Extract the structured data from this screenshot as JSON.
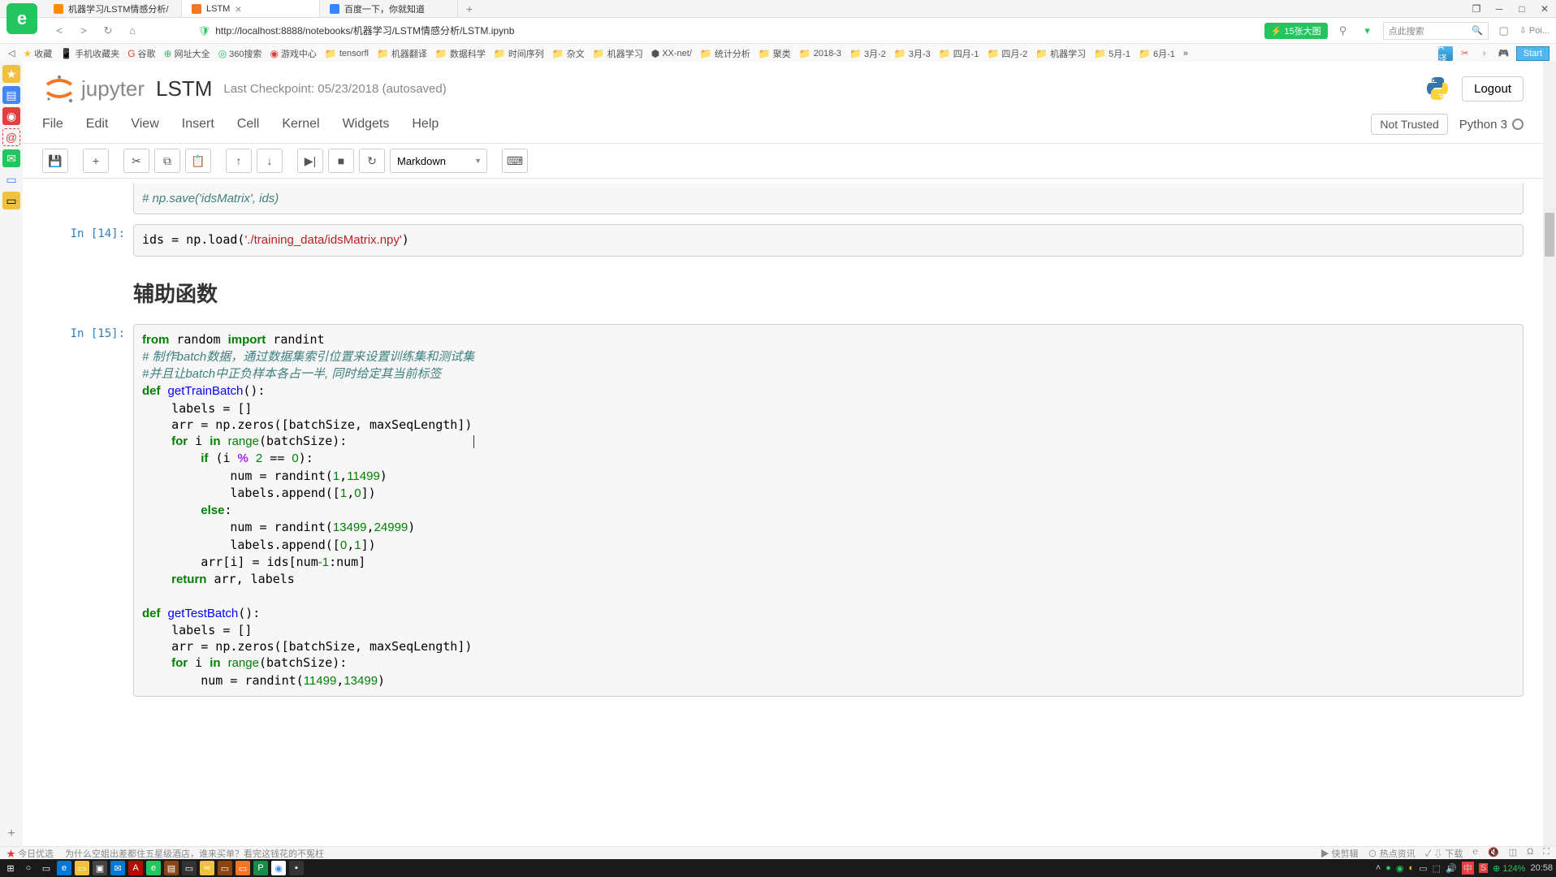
{
  "browser": {
    "tabs": [
      "机器学习/LSTM情感分析/",
      "LSTM",
      "百度一下，你就知道"
    ],
    "url": "http://localhost:8888/notebooks/机器学习/LSTM情感分析/LSTM.ipynb",
    "badge": "⚡ 15张大图",
    "search_placeholder": "点此搜索",
    "start": "Start",
    "point_text": "⇩ Poi...",
    "window_icon": "❐"
  },
  "bookmarks": [
    "收藏",
    "手机收藏夹",
    "谷歌",
    "网址大全",
    "360搜索",
    "游戏中心",
    "tensorfl",
    "机器翻译",
    "数据科学",
    "时间序列",
    "杂文",
    "机器学习",
    "XX-net/",
    "统计分析",
    "聚类",
    "2018-3",
    "3月-2",
    "3月-3",
    "四月-1",
    "四月-2",
    "机器学习",
    "5月-1",
    "6月-1"
  ],
  "jupyter": {
    "brand": "jupyter",
    "title": "LSTM",
    "checkpoint": "Last Checkpoint: 05/23/2018 (autosaved)",
    "logout": "Logout",
    "menus": [
      "File",
      "Edit",
      "View",
      "Insert",
      "Cell",
      "Kernel",
      "Widgets",
      "Help"
    ],
    "not_trusted": "Not Trusted",
    "kernel": "Python 3",
    "cell_type": "Markdown"
  },
  "cells": {
    "c0": {
      "prompt": " ",
      "code": "# np.save('idsMatrix', ids)"
    },
    "c1": {
      "prompt": "In [14]:"
    },
    "md": {
      "heading": "辅助函数"
    },
    "c2": {
      "prompt": "In [15]:"
    }
  },
  "statusbar": {
    "left1": "今日优选",
    "left2": "为什么空姐出差都住五星级酒店，谁来买单？看完这钱花的不冤枉",
    "r1": "▶ 快剪辑",
    "r2": "⊙ 热点资讯",
    "r3": "✓ ⇩ 下载",
    "r4": "℮"
  },
  "taskbar": {
    "time": "20:58",
    "tray_extra": "⊕ 124%"
  }
}
